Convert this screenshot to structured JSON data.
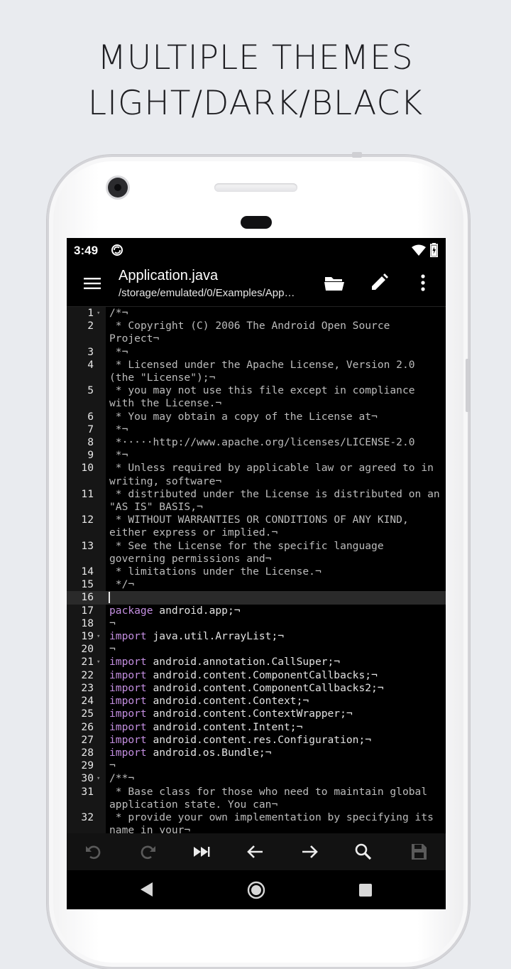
{
  "headline": {
    "line1": "MULTIPLE THEMES",
    "line2": "LIGHT/DARK/BLACK"
  },
  "status_bar": {
    "time": "3:49",
    "icons": [
      "sync-icon",
      "wifi-icon",
      "battery-charging-icon"
    ]
  },
  "app_bar": {
    "title": "Application.java",
    "subtitle": "/storage/emulated/0/Examples/App…",
    "actions": [
      "menu-icon",
      "folder-open-icon",
      "pencil-icon",
      "more-vert-icon"
    ]
  },
  "editor": {
    "current_line": 16,
    "lines": [
      {
        "num": "1",
        "fold": true,
        "style": "comment",
        "kw": "",
        "rest": "/*¬"
      },
      {
        "num": "2",
        "fold": false,
        "style": "comment",
        "kw": "",
        "rest": " * Copyright (C) 2006 The Android Open Source Project¬"
      },
      {
        "num": "3",
        "fold": false,
        "style": "comment",
        "kw": "",
        "rest": " *¬"
      },
      {
        "num": "4",
        "fold": false,
        "style": "comment",
        "kw": "",
        "rest": " * Licensed under the Apache License, Version 2.0 (the \"License\");¬"
      },
      {
        "num": "5",
        "fold": false,
        "style": "comment",
        "kw": "",
        "rest": " * you may not use this file except in compliance with the License.¬"
      },
      {
        "num": "6",
        "fold": false,
        "style": "comment",
        "kw": "",
        "rest": " * You may obtain a copy of the License at¬"
      },
      {
        "num": "7",
        "fold": false,
        "style": "comment",
        "kw": "",
        "rest": " *¬"
      },
      {
        "num": "8",
        "fold": false,
        "style": "comment",
        "kw": "",
        "rest": " *·····http://www.apache.org/licenses/LICENSE-2.0"
      },
      {
        "num": "9",
        "fold": false,
        "style": "comment",
        "kw": "",
        "rest": " *¬"
      },
      {
        "num": "10",
        "fold": false,
        "style": "comment",
        "kw": "",
        "rest": " * Unless required by applicable law or agreed to in writing, software¬"
      },
      {
        "num": "11",
        "fold": false,
        "style": "comment",
        "kw": "",
        "rest": " * distributed under the License is distributed on an \"AS IS\" BASIS,¬"
      },
      {
        "num": "12",
        "fold": false,
        "style": "comment",
        "kw": "",
        "rest": " * WITHOUT WARRANTIES OR CONDITIONS OF ANY KIND, either express or implied.¬"
      },
      {
        "num": "13",
        "fold": false,
        "style": "comment",
        "kw": "",
        "rest": " * See the License for the specific language governing permissions and¬"
      },
      {
        "num": "14",
        "fold": false,
        "style": "comment",
        "kw": "",
        "rest": " * limitations under the License.¬"
      },
      {
        "num": "15",
        "fold": false,
        "style": "comment",
        "kw": "",
        "rest": " */¬"
      },
      {
        "num": "16",
        "fold": false,
        "style": "code",
        "kw": "",
        "rest": ""
      },
      {
        "num": "17",
        "fold": false,
        "style": "code",
        "kw": "package",
        "rest": " android.app;¬"
      },
      {
        "num": "18",
        "fold": false,
        "style": "comment",
        "kw": "",
        "rest": "¬"
      },
      {
        "num": "19",
        "fold": true,
        "style": "code",
        "kw": "import",
        "rest": " java.util.ArrayList;¬"
      },
      {
        "num": "20",
        "fold": false,
        "style": "comment",
        "kw": "",
        "rest": "¬"
      },
      {
        "num": "21",
        "fold": true,
        "style": "code",
        "kw": "import",
        "rest": " android.annotation.CallSuper;¬"
      },
      {
        "num": "22",
        "fold": false,
        "style": "code",
        "kw": "import",
        "rest": " android.content.ComponentCallbacks;¬"
      },
      {
        "num": "23",
        "fold": false,
        "style": "code",
        "kw": "import",
        "rest": " android.content.ComponentCallbacks2;¬"
      },
      {
        "num": "24",
        "fold": false,
        "style": "code",
        "kw": "import",
        "rest": " android.content.Context;¬"
      },
      {
        "num": "25",
        "fold": false,
        "style": "code",
        "kw": "import",
        "rest": " android.content.ContextWrapper;¬"
      },
      {
        "num": "26",
        "fold": false,
        "style": "code",
        "kw": "import",
        "rest": " android.content.Intent;¬"
      },
      {
        "num": "27",
        "fold": false,
        "style": "code",
        "kw": "import",
        "rest": " android.content.res.Configuration;¬"
      },
      {
        "num": "28",
        "fold": false,
        "style": "code",
        "kw": "import",
        "rest": " android.os.Bundle;¬"
      },
      {
        "num": "29",
        "fold": false,
        "style": "comment",
        "kw": "",
        "rest": "¬"
      },
      {
        "num": "30",
        "fold": true,
        "style": "comment",
        "kw": "",
        "rest": "/**¬"
      },
      {
        "num": "31",
        "fold": false,
        "style": "comment",
        "kw": "",
        "rest": " * Base class for those who need to maintain global application state. You can¬"
      },
      {
        "num": "32",
        "fold": false,
        "style": "comment",
        "kw": "",
        "rest": " * provide your own implementation by specifying its name in your¬"
      }
    ]
  },
  "bottom_toolbar": {
    "buttons": [
      "undo-icon",
      "redo-icon",
      "fast-forward-icon",
      "arrow-left-icon",
      "arrow-right-icon",
      "search-icon",
      "save-icon"
    ]
  },
  "nav_bar": {
    "buttons": [
      "back-icon",
      "home-icon",
      "recents-icon"
    ]
  },
  "colors": {
    "keyword": "#c38ee0",
    "text": "#e2e2e2",
    "comment": "#bcbcbc",
    "gutter": "#161616",
    "current_line": "#2a2a2a"
  }
}
